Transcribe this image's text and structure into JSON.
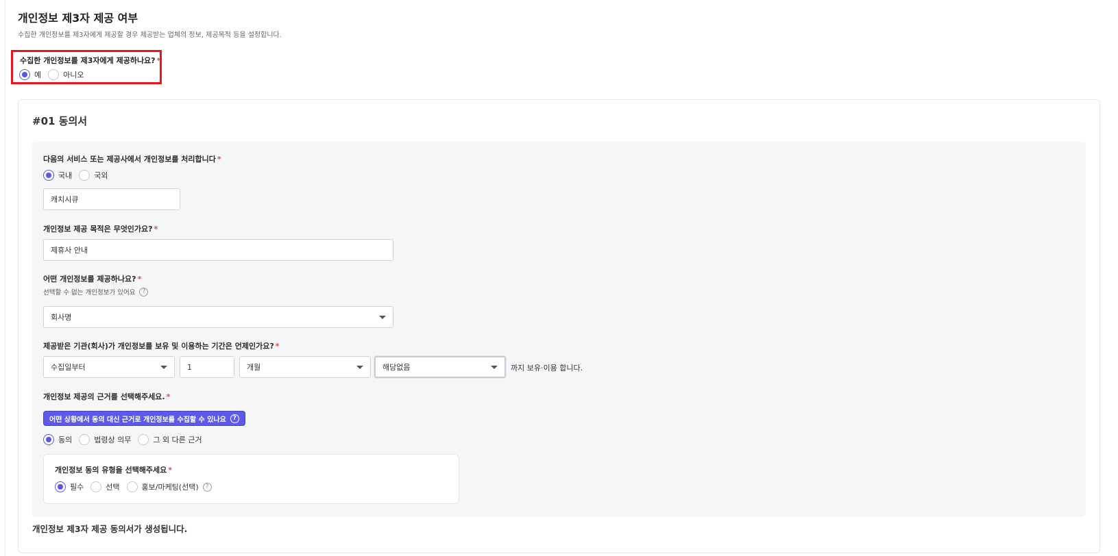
{
  "section": {
    "title": "개인정보 제3자 제공 여부",
    "description": "수집한 개인정보를 제3자에게 제공할 경우 제공받는 업체의 정보, 제공목적 등을 설정합니다."
  },
  "provide_question": {
    "label": "수집한 개인정보를 제3자에게 제공하나요?",
    "required_mark": "*",
    "options": [
      {
        "label": "예",
        "checked": true
      },
      {
        "label": "아니오",
        "checked": false
      }
    ]
  },
  "consent_card": {
    "title": "#01 동의서",
    "service": {
      "label": "다음의 서비스 또는 제공사에서 개인정보를 처리합니다",
      "required_mark": "*",
      "options": [
        {
          "label": "국내",
          "checked": true
        },
        {
          "label": "국외",
          "checked": false
        }
      ],
      "value": "캐치시큐"
    },
    "purpose": {
      "label": "개인정보 제공 목적은 무엇인가요?",
      "required_mark": "*",
      "value": "제휴사 안내"
    },
    "items": {
      "label": "어떤 개인정보를 제공하나요?",
      "required_mark": "*",
      "sub_label": "선택할 수 없는 개인정보가 있어요",
      "help_icon": "question-circle-icon",
      "selected": "회사명"
    },
    "retention": {
      "label": "제공받은 기관(회사)가 개인정보를 보유 및 이용하는 기간은 언제인가요?",
      "required_mark": "*",
      "start_selected": "수집일부터",
      "amount_value": "1",
      "unit_selected": "개월",
      "extra_selected": "해당없음",
      "suffix": "까지 보유·이용 합니다."
    },
    "basis": {
      "label": "개인정보 제공의 근거를 선택해주세요.",
      "required_mark": "*",
      "info_badge": "어떤 상황에서 동의 대신 근거로 개인정보를 수집할 수 있나요",
      "options": [
        {
          "label": "동의",
          "checked": true
        },
        {
          "label": "법령상 의무",
          "checked": false
        },
        {
          "label": "그 외 다른 근거",
          "checked": false
        }
      ]
    },
    "consent_type": {
      "label": "개인정보 동의 유형을 선택해주세요",
      "required_mark": "*",
      "options": [
        {
          "label": "필수",
          "checked": true
        },
        {
          "label": "선택",
          "checked": false
        },
        {
          "label": "홍보/마케팅(선택)",
          "checked": false
        }
      ]
    },
    "footer": "개인정보 제3자 제공 동의서가 생성됩니다."
  },
  "colors": {
    "accent": "#5b56e0",
    "highlight_border": "#e8141b",
    "required": "#e5484d",
    "panel_bg": "#f5f6f8"
  }
}
